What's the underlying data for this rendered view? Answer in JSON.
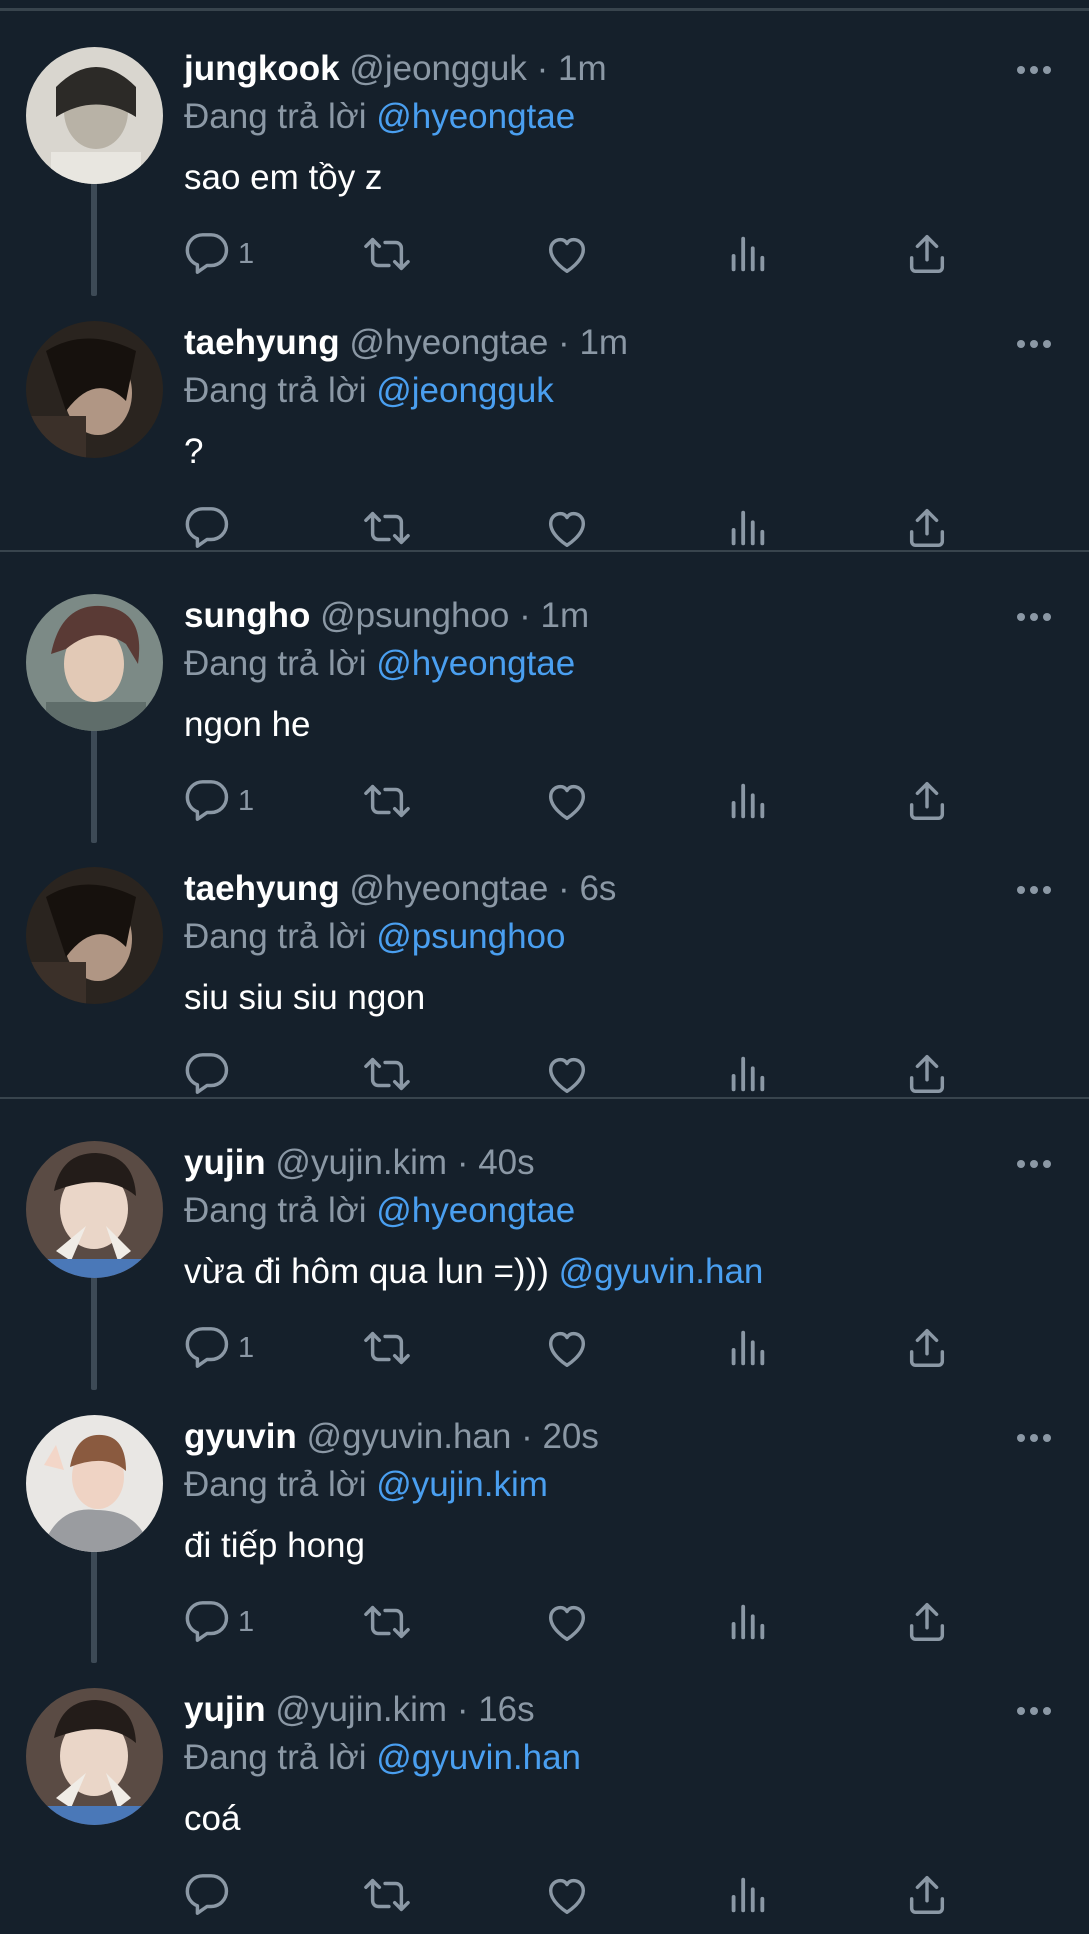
{
  "reply_prefix": "Đang trả lời",
  "colors": {
    "background": "#15202b",
    "separator": "#38444d",
    "mention": "#4a9ff0",
    "muted": "#8b98a5"
  },
  "action_icons": [
    "reply-icon",
    "retweet-icon",
    "like-icon",
    "views-icon",
    "share-icon"
  ],
  "tweets": [
    {
      "name": "jungkook",
      "handle": "@jeongguk",
      "sep": " · ",
      "time": "1m",
      "reply_to": "@hyeongtae",
      "text": "sao em tồy z",
      "text_mention": "",
      "reply_count": "1"
    },
    {
      "name": "taehyung",
      "handle": "@hyeongtae",
      "sep": " · ",
      "time": "1m",
      "reply_to": "@jeongguk",
      "text": "?",
      "text_mention": "",
      "reply_count": ""
    },
    {
      "name": "sungho",
      "handle": "@psunghoo",
      "sep": " · ",
      "time": "1m",
      "reply_to": "@hyeongtae",
      "text": "ngon he",
      "text_mention": "",
      "reply_count": "1"
    },
    {
      "name": "taehyung",
      "handle": "@hyeongtae",
      "sep": " · ",
      "time": "6s",
      "reply_to": "@psunghoo",
      "text": "siu siu siu ngon",
      "text_mention": "",
      "reply_count": ""
    },
    {
      "name": "yujin",
      "handle": "@yujin.kim",
      "sep": " · ",
      "time": "40s",
      "reply_to": "@hyeongtae",
      "text": "vừa đi hôm qua lun =))) ",
      "text_mention": "@gyuvin.han",
      "reply_count": "1"
    },
    {
      "name": "gyuvin",
      "handle": "@gyuvin.han",
      "sep": " · ",
      "time": "20s",
      "reply_to": "@yujin.kim",
      "text": "đi tiếp hong",
      "text_mention": "",
      "reply_count": "1"
    },
    {
      "name": "yujin",
      "handle": "@yujin.kim",
      "sep": " · ",
      "time": "16s",
      "reply_to": "@gyuvin.han",
      "text": "coá",
      "text_mention": "",
      "reply_count": ""
    }
  ]
}
